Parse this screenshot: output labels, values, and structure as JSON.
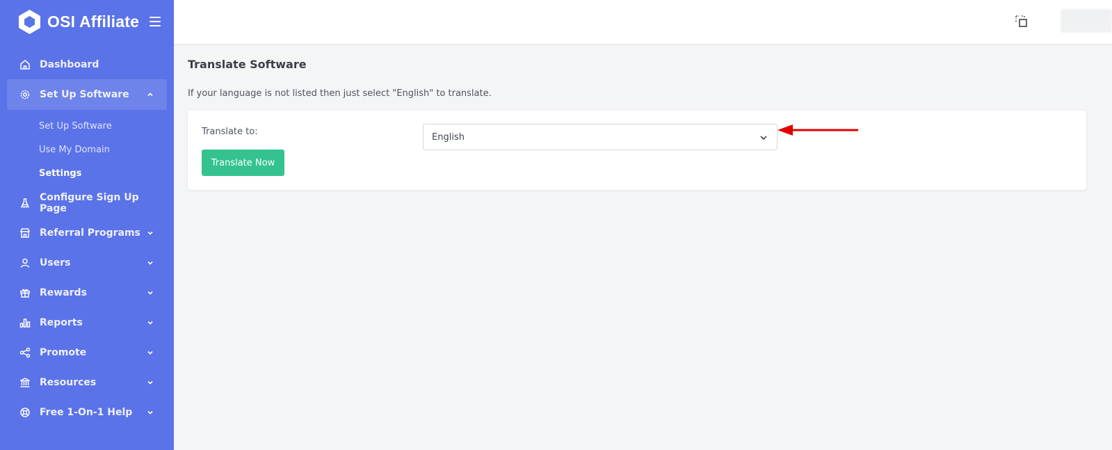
{
  "brand": {
    "name": "OSI Affiliate"
  },
  "sidebar": {
    "items": [
      {
        "label": "Dashboard",
        "icon": "home-icon",
        "has_chevron": false
      },
      {
        "label": "Set Up Software",
        "icon": "gear-icon",
        "has_chevron": true,
        "expanded": true,
        "children": [
          {
            "label": "Set Up Software"
          },
          {
            "label": "Use My Domain"
          },
          {
            "label": "Settings",
            "current": true
          }
        ]
      },
      {
        "label": "Configure Sign Up Page",
        "icon": "flask-icon",
        "has_chevron": false
      },
      {
        "label": "Referral Programs",
        "icon": "store-icon",
        "has_chevron": true
      },
      {
        "label": "Users",
        "icon": "user-icon",
        "has_chevron": true
      },
      {
        "label": "Rewards",
        "icon": "gift-icon",
        "has_chevron": true
      },
      {
        "label": "Reports",
        "icon": "bar-chart-icon",
        "has_chevron": true
      },
      {
        "label": "Promote",
        "icon": "share-icon",
        "has_chevron": true
      },
      {
        "label": "Resources",
        "icon": "bank-icon",
        "has_chevron": true
      },
      {
        "label": "Free 1-On-1 Help",
        "icon": "lifebuoy-icon",
        "has_chevron": true
      }
    ]
  },
  "main": {
    "title": "Translate Software",
    "description": "If your language is not listed then just select \"English\" to translate.",
    "form": {
      "label": "Translate to:",
      "selected_language": "English",
      "button_label": "Translate Now"
    }
  },
  "colors": {
    "sidebar": "#5b73e8",
    "button": "#34c38f",
    "annotation_arrow": "#e00000"
  }
}
